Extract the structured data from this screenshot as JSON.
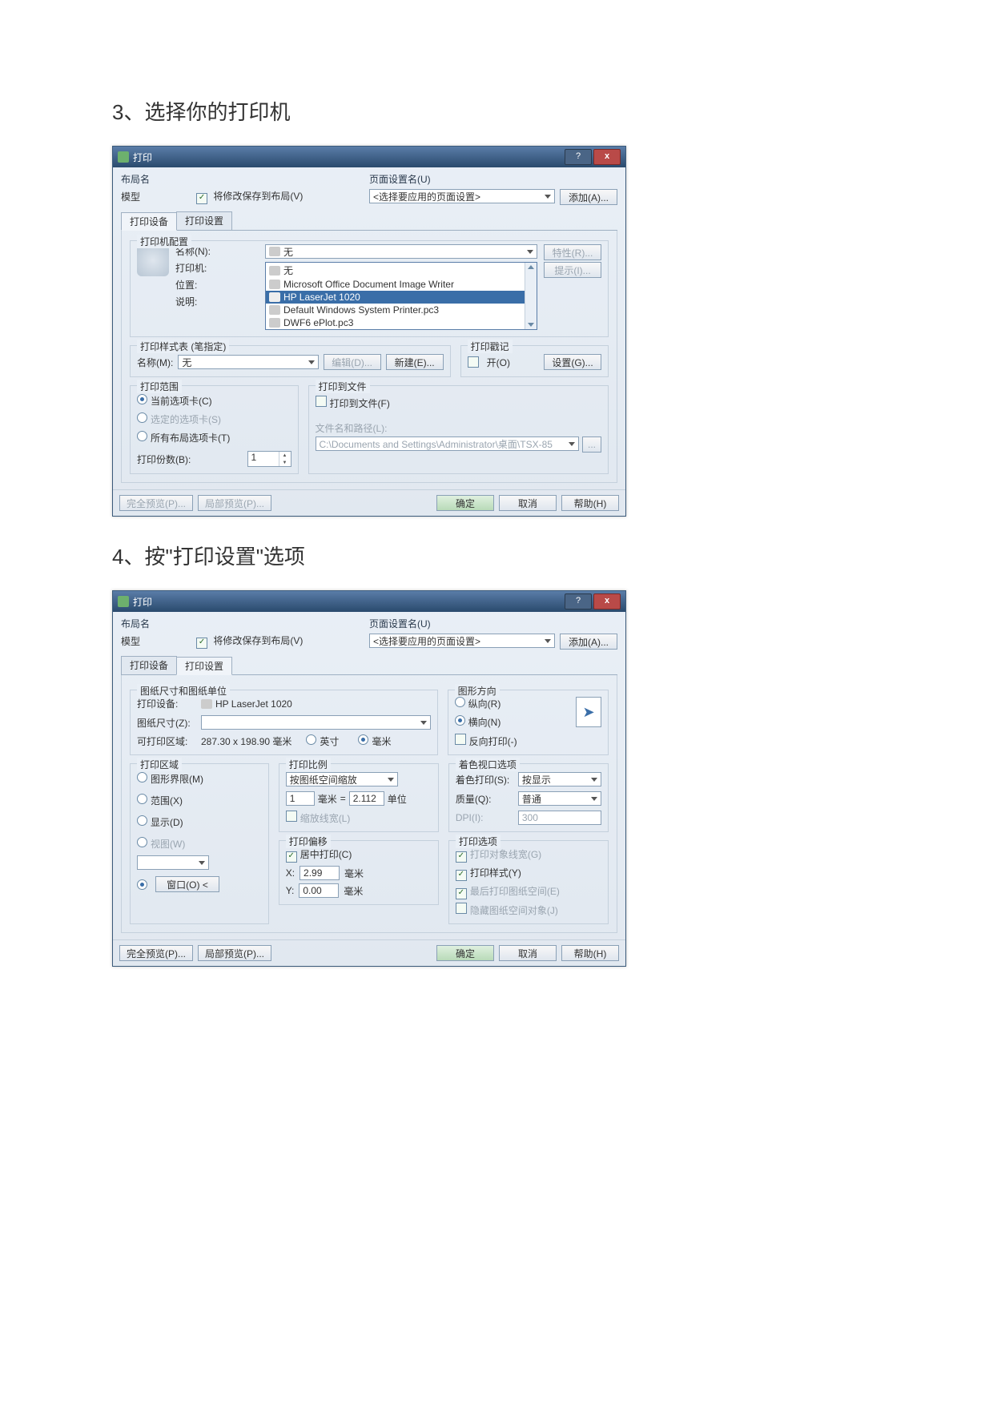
{
  "doc": {
    "step3_title": "3、选择你的打印机",
    "step4_title": "4、按\"打印设置\"选项"
  },
  "common": {
    "window_title": "打印",
    "help_btn": "?",
    "close_btn": "x",
    "layout_name_label": "布局名",
    "layout_name_value": "模型",
    "save_to_layout_label": "将修改保存到布局(V)",
    "page_setup_label": "页面设置名(U)",
    "page_setup_value": "<选择要应用的页面设置>",
    "add_btn": "添加(A)...",
    "tab_device": "打印设备",
    "tab_settings": "打印设置",
    "full_preview": "完全预览(P)...",
    "partial_preview": "局部预览(P)...",
    "ok": "确定",
    "cancel": "取消",
    "help": "帮助(H)"
  },
  "d1": {
    "printer_config": "打印机配置",
    "name_label": "名称(N):",
    "printer_label": "打印机:",
    "location_label": "位置:",
    "desc_label": "说明:",
    "name_value": "无",
    "properties_btn": "特性(R)...",
    "hint_btn": "提示(I)...",
    "options": [
      "无",
      "Microsoft Office Document Image Writer",
      "HP LaserJet 1020",
      "Default Windows System Printer.pc3",
      "DWF6 ePlot.pc3"
    ],
    "selected_option_index": 2,
    "style_table_label": "打印样式表 (笔指定)",
    "style_name_label": "名称(M):",
    "style_value": "无",
    "edit_btn": "编辑(D)...",
    "new_btn": "新建(E)...",
    "stamp_label": "打印戳记",
    "stamp_on": "开(O)",
    "stamp_settings": "设置(G)...",
    "range_label": "打印范围",
    "range_current": "当前选项卡(C)",
    "range_selected": "选定的选项卡(S)",
    "range_all": "所有布局选项卡(T)",
    "copies_label": "打印份数(B):",
    "copies_value": "1",
    "to_file_group": "打印到文件",
    "to_file_chk": "打印到文件(F)",
    "file_path_label": "文件名和路径(L):",
    "file_path_value": "C:\\Documents and Settings\\Administrator\\桌面\\TSX-85",
    "browse": "..."
  },
  "d2": {
    "size_group": "图纸尺寸和图纸单位",
    "device_label": "打印设备:",
    "device_value": "HP LaserJet 1020",
    "size_label": "图纸尺寸(Z):",
    "printable_label": "可打印区域:",
    "printable_value": "287.30 x 198.90 毫米",
    "unit_inch": "英寸",
    "unit_mm": "毫米",
    "orient_group": "图形方向",
    "orient_portrait": "纵向(R)",
    "orient_landscape": "横向(N)",
    "orient_reverse": "反向打印(-)",
    "area_group": "打印区域",
    "area_limits": "图形界限(M)",
    "area_extents": "范围(X)",
    "area_display": "显示(D)",
    "area_view": "视图(W)",
    "area_window": "窗口(O) <",
    "scale_group": "打印比例",
    "scale_value": "按图纸空间缩放",
    "scale_left": "1",
    "scale_unit_left": "毫米",
    "scale_eq": "=",
    "scale_right": "2.112",
    "scale_unit_right": "单位",
    "scale_lineweight": "缩放线宽(L)",
    "offset_group": "打印偏移",
    "offset_center": "居中打印(C)",
    "offset_x_label": "X:",
    "offset_x_value": "2.99",
    "offset_y_label": "Y:",
    "offset_y_value": "0.00",
    "offset_unit": "毫米",
    "viewport_group": "着色视口选项",
    "shade_label": "着色打印(S):",
    "shade_value": "按显示",
    "quality_label": "质量(Q):",
    "quality_value": "普通",
    "dpi_label": "DPI(I):",
    "dpi_value": "300",
    "options_group": "打印选项",
    "opt_lineweight": "打印对象线宽(G)",
    "opt_styles": "打印样式(Y)",
    "opt_last": "最后打印图纸空间(E)",
    "opt_hide": "隐藏图纸空间对象(J)"
  }
}
